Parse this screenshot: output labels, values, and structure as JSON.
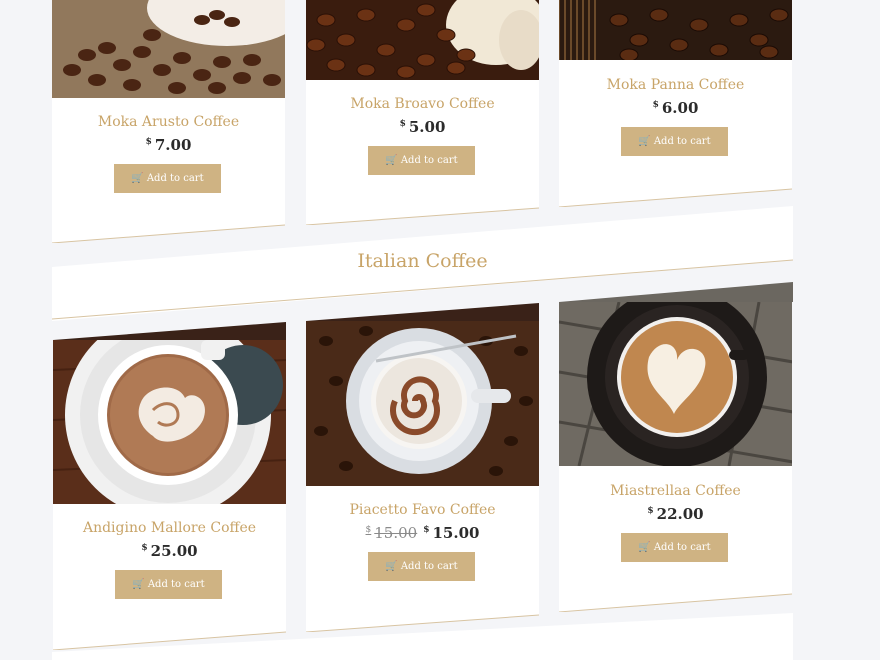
{
  "top_products": [
    {
      "name": "Moka Arusto Coffee",
      "currency": "$",
      "price": "7.00",
      "button": "Add to cart"
    },
    {
      "name": "Moka Broavo Coffee",
      "currency": "$",
      "price": "5.00",
      "button": "Add to cart"
    },
    {
      "name": "Moka Panna Coffee",
      "currency": "$",
      "price": "6.00",
      "button": "Add to cart"
    }
  ],
  "section": {
    "title": "Italian Coffee"
  },
  "italian_products": [
    {
      "name": "Andigino Mallore Coffee",
      "currency": "$",
      "price": "25.00",
      "button": "Add to cart"
    },
    {
      "name": "Piacetto Favo Coffee",
      "currency": "$",
      "old_price": "15.00",
      "price": "15.00",
      "button": "Add to cart"
    },
    {
      "name": "Miastrellaa Coffee",
      "currency": "$",
      "price": "22.00",
      "button": "Add to cart"
    }
  ],
  "icons": {
    "cart": "shopping-cart-icon"
  },
  "colors": {
    "accent": "#c8a468",
    "button": "#cfb383",
    "page_bg": "#f4f5f8"
  }
}
